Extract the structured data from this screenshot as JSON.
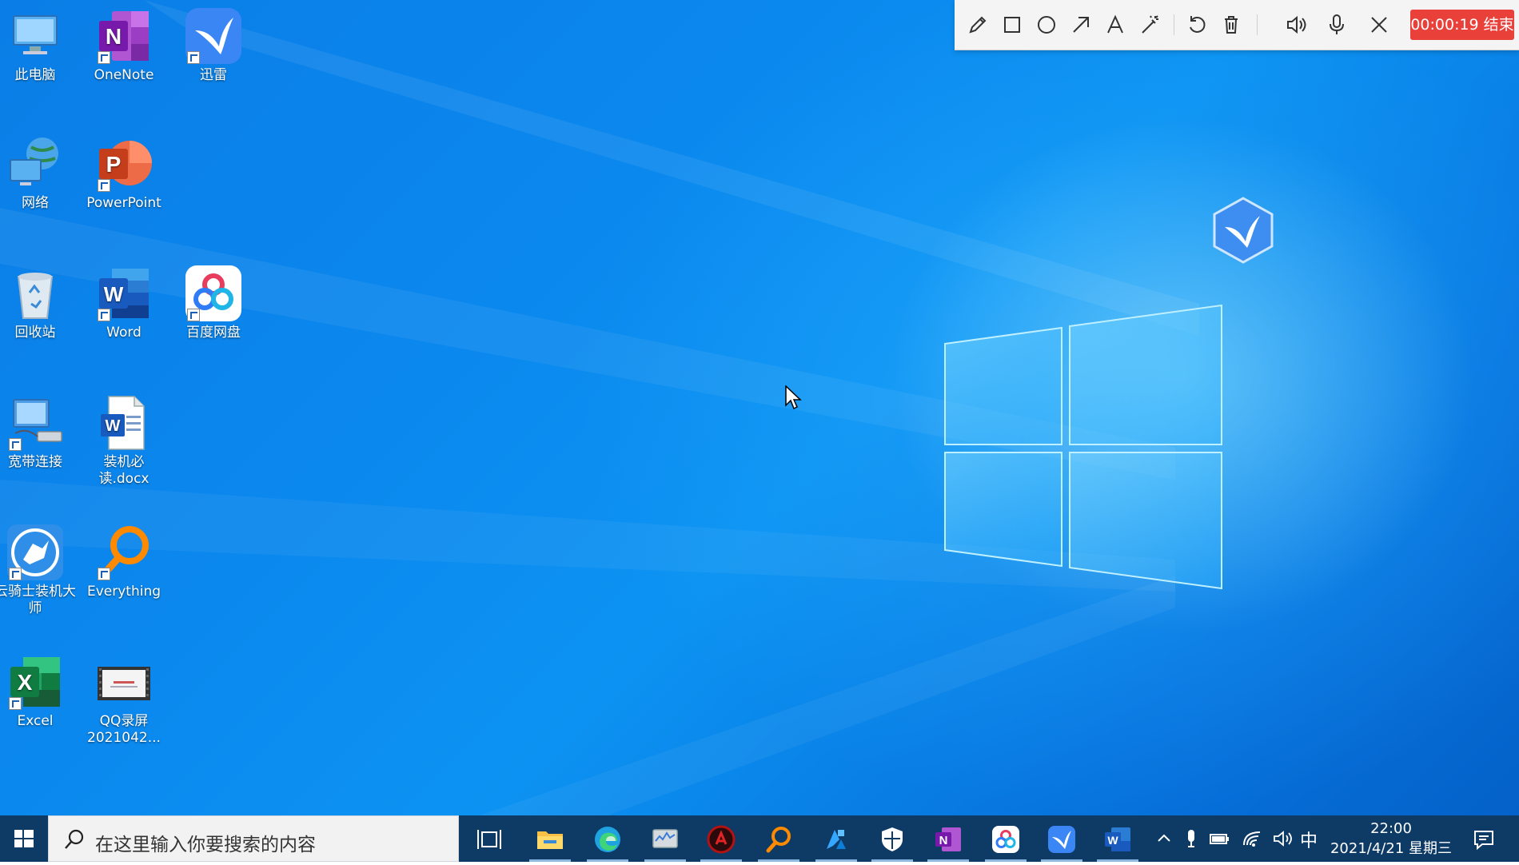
{
  "toolbar": {
    "timer_label": "00:00:19 结束",
    "tools": [
      "pencil-icon",
      "rectangle-icon",
      "ellipse-icon",
      "arrow-icon",
      "text-icon",
      "magic-wand-icon",
      "undo-icon",
      "trash-icon",
      "speaker-icon",
      "microphone-icon",
      "close-icon"
    ]
  },
  "desktop": {
    "icons": [
      {
        "label": "此电脑",
        "icon": "this-pc-icon"
      },
      {
        "label": "OneNote",
        "icon": "onenote-icon"
      },
      {
        "label": "迅雷",
        "icon": "thunder-icon"
      },
      {
        "label": "网络",
        "icon": "network-icon"
      },
      {
        "label": "PowerPoint",
        "icon": "powerpoint-icon"
      },
      {
        "label": "回收站",
        "icon": "recycle-bin-icon"
      },
      {
        "label": "Word",
        "icon": "word-icon"
      },
      {
        "label": "百度网盘",
        "icon": "baidu-netdisk-icon"
      },
      {
        "label": "宽带连接",
        "icon": "broadband-icon"
      },
      {
        "label": "装机必读.docx",
        "icon": "docx-file-icon"
      },
      {
        "label": "云骑士装机大师",
        "icon": "yunqishi-icon"
      },
      {
        "label": "Everything",
        "icon": "everything-icon"
      },
      {
        "label": "Excel",
        "icon": "excel-icon"
      },
      {
        "label": "QQ录屏2021042...",
        "icon": "video-file-icon"
      }
    ]
  },
  "taskbar": {
    "search_placeholder": "在这里输入你要搜索的内容",
    "ime_label": "中",
    "time": "22:00",
    "date": "2021/4/21 星期三",
    "apps": [
      "task-view-icon",
      "file-explorer-icon",
      "edge-icon",
      "system-monitor-icon",
      "red-app-icon",
      "everything-icon",
      "azure-icon",
      "security-icon",
      "onenote-icon",
      "baidu-netdisk-icon",
      "thunder-icon",
      "word-icon"
    ]
  },
  "colors": {
    "accent_red": "#e9403a",
    "taskbar": "#0e3a66",
    "desktop_blue": "#0b88ee"
  }
}
